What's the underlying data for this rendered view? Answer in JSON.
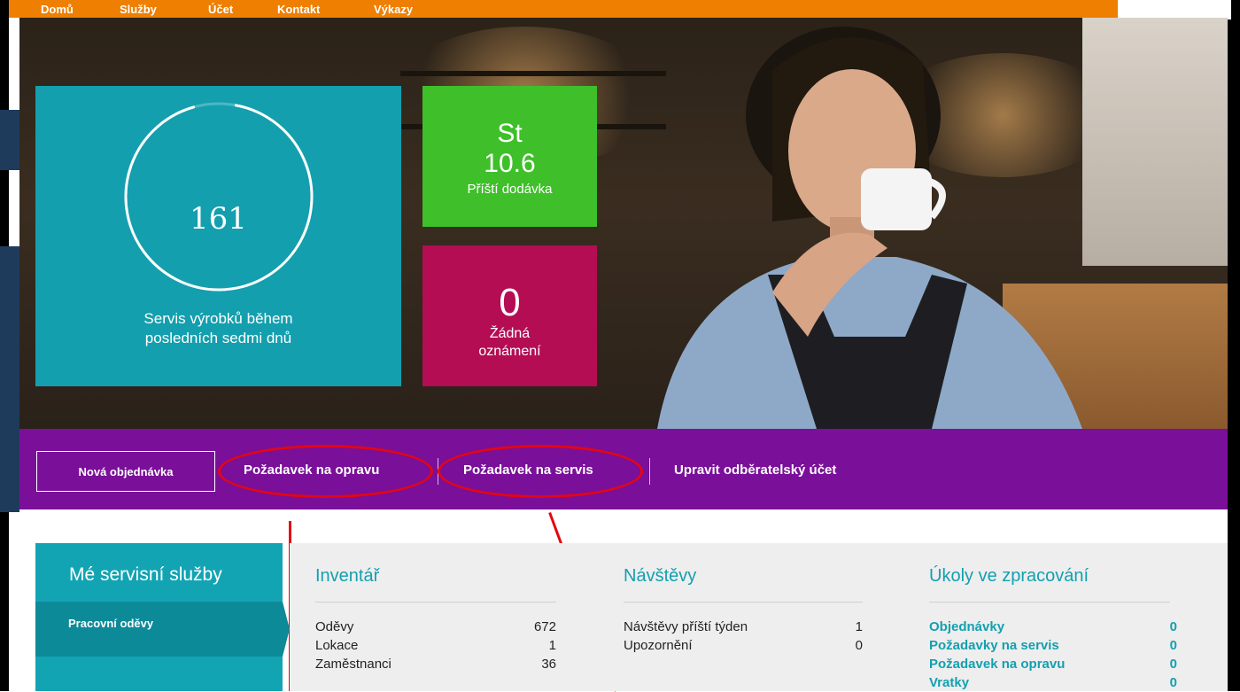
{
  "nav": {
    "items": [
      "Domů",
      "Služby",
      "Účet",
      "Kontakt",
      "Výkazy"
    ],
    "search_placeholder": ""
  },
  "tiles": {
    "service": {
      "value": "161",
      "caption_line1": "Servis výrobků během",
      "caption_line2": "posledních sedmi dnů"
    },
    "delivery": {
      "day": "St",
      "date": "10.6",
      "caption": "Příští dodávka"
    },
    "notifications": {
      "count": "0",
      "caption_line1": "Žádná",
      "caption_line2": "oznámení"
    }
  },
  "actions": {
    "new_order": "Nová objednávka",
    "repair_request": "Požadavek na opravu",
    "service_request": "Požadavek na servis",
    "edit_account": "Upravit odběratelský účet"
  },
  "sidemenu": {
    "title": "Mé servisní služby",
    "items": [
      "Pracovní oděvy"
    ]
  },
  "inventory": {
    "title": "Inventář",
    "rows": [
      {
        "label": "Oděvy",
        "value": "672"
      },
      {
        "label": "Lokace",
        "value": "1"
      },
      {
        "label": "Zaměstnanci",
        "value": "36"
      }
    ]
  },
  "visits": {
    "title": "Návštěvy",
    "rows": [
      {
        "label": "Návštěvy příští týden",
        "value": "1"
      },
      {
        "label": "Upozornění",
        "value": "0"
      }
    ]
  },
  "tasks": {
    "title": "Úkoly ve zpracování",
    "rows": [
      {
        "label": "Objednávky",
        "value": "0"
      },
      {
        "label": "Požadavky na servis",
        "value": "0"
      },
      {
        "label": "Požadavek na opravu",
        "value": "0"
      },
      {
        "label": "Vratky",
        "value": "0"
      }
    ]
  },
  "colors": {
    "nav": "#ee7f00",
    "tile_service": "#139fae",
    "tile_delivery": "#3fbf2a",
    "tile_notifications": "#b40d54",
    "action_bar": "#7a0f99",
    "annotation": "#e30613"
  }
}
